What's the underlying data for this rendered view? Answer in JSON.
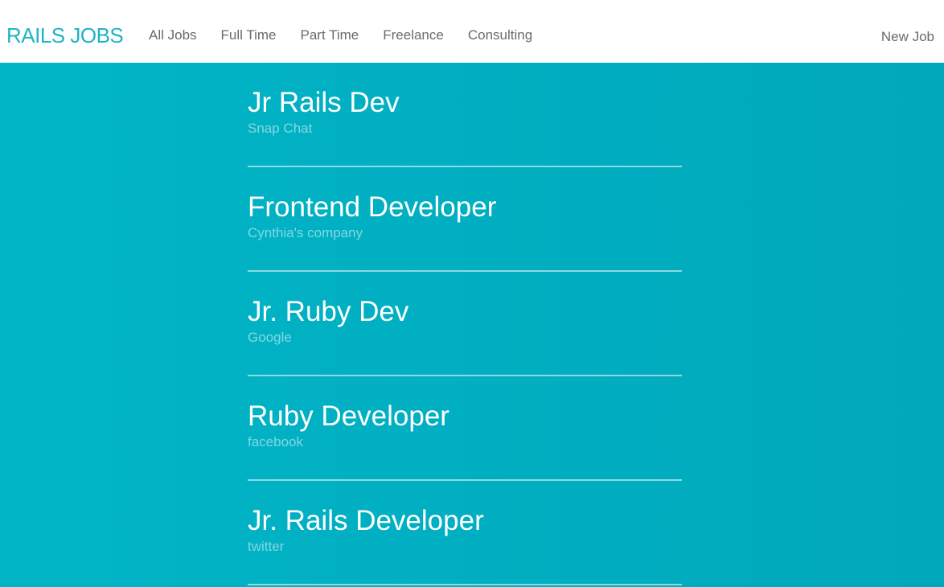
{
  "colors": {
    "brand": "#1fb3c6",
    "nav_text": "#6a6a6a",
    "main_bg": "#01b1c3",
    "title_text": "#ffffff"
  },
  "navbar": {
    "brand": "RAILS JOBS",
    "links": [
      {
        "label": "All Jobs"
      },
      {
        "label": "Full Time"
      },
      {
        "label": "Part Time"
      },
      {
        "label": "Freelance"
      },
      {
        "label": "Consulting"
      }
    ],
    "new_job": "New Job"
  },
  "jobs": [
    {
      "title": "Jr Rails Dev",
      "company": "Snap Chat"
    },
    {
      "title": "Frontend Developer",
      "company": "Cynthia's company"
    },
    {
      "title": "Jr. Ruby Dev",
      "company": "Google"
    },
    {
      "title": "Ruby Developer",
      "company": "facebook"
    },
    {
      "title": "Jr. Rails Developer",
      "company": "twitter"
    }
  ]
}
